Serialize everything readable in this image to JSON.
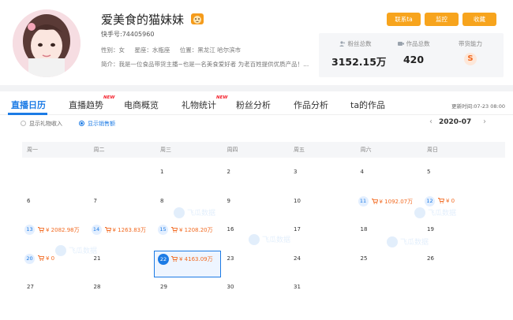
{
  "profile": {
    "name": "爱美食的猫妹妹",
    "uid": "快手号:74405960",
    "gender": "性别：女",
    "zodiac": "星座：水瓶座",
    "location": "位置：黑龙江 哈尔滨市",
    "intro": "简介：我是一位食品带货主播~也是一名美食爱好者 为老百姓提供优质产品！...",
    "buttons": {
      "contact": "联系ta",
      "monitor": "监控",
      "favorite": "收藏"
    },
    "stats": {
      "fans_label": "粉丝总数",
      "fans_value": "3152.15万",
      "works_label": "作品总数",
      "works_value": "420",
      "ability_label": "带货能力",
      "ability_value": "S"
    }
  },
  "tabs": [
    {
      "label": "直播日历",
      "new": ""
    },
    {
      "label": "直播趋势",
      "new": "NEW"
    },
    {
      "label": "电商概览",
      "new": ""
    },
    {
      "label": "礼物统计",
      "new": "NEW"
    },
    {
      "label": "粉丝分析",
      "new": ""
    },
    {
      "label": "作品分析",
      "new": ""
    },
    {
      "label": "ta的作品",
      "new": ""
    }
  ],
  "updated_time": "更新时间:07-23 08:00",
  "radios": {
    "gift": "显示礼物收入",
    "sales": "显示销售额"
  },
  "month": "2020-07",
  "nav": {
    "prev": "‹",
    "next": "›"
  },
  "weekdays": [
    "周一",
    "周二",
    "周三",
    "周四",
    "周五",
    "周六",
    "周日"
  ],
  "watermark": "飞瓜数据",
  "colors": {
    "accent": "#1c7be5",
    "orange": "#f7a41d",
    "amount": "#f26a21"
  },
  "days": [
    {
      "d": "1"
    },
    {
      "d": "2"
    },
    {
      "d": "3"
    },
    {
      "d": "4"
    },
    {
      "d": "5"
    },
    {
      "d": "6"
    },
    {
      "d": "7"
    },
    {
      "d": "8"
    },
    {
      "d": "9"
    },
    {
      "d": "10"
    },
    {
      "d": "11",
      "amt": "¥ 1092.07万"
    },
    {
      "d": "12",
      "amt": "¥ 0"
    },
    {
      "d": "13",
      "amt": "¥ 2082.98万"
    },
    {
      "d": "14",
      "amt": "¥ 1263.83万"
    },
    {
      "d": "15",
      "amt": "¥ 1208.20万"
    },
    {
      "d": "16"
    },
    {
      "d": "17"
    },
    {
      "d": "18"
    },
    {
      "d": "19"
    },
    {
      "d": "20",
      "amt": "¥ 0"
    },
    {
      "d": "21"
    },
    {
      "d": "22",
      "amt": "¥ 4163.09万",
      "selected": true
    },
    {
      "d": "23"
    },
    {
      "d": "24"
    },
    {
      "d": "25"
    },
    {
      "d": "26"
    },
    {
      "d": "27"
    },
    {
      "d": "28"
    },
    {
      "d": "29"
    },
    {
      "d": "30"
    },
    {
      "d": "31"
    }
  ]
}
